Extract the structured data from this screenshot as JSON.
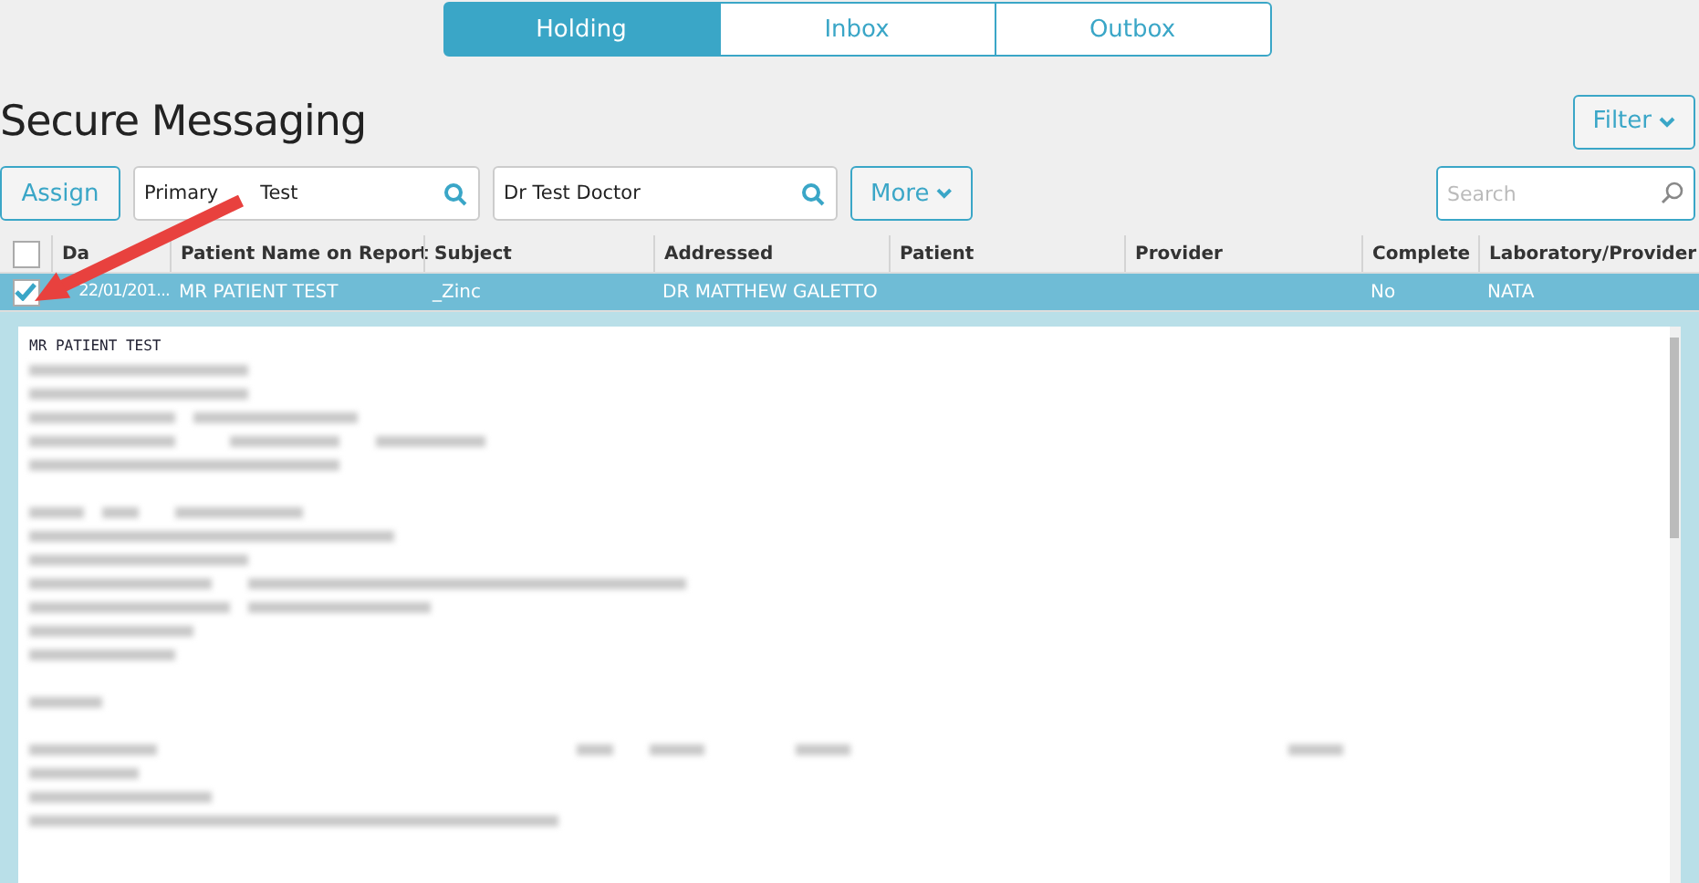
{
  "tabs": [
    {
      "label": "Holding",
      "selected": true
    },
    {
      "label": "Inbox",
      "selected": false
    },
    {
      "label": "Outbox",
      "selected": false
    }
  ],
  "title": "Secure Messaging",
  "filter_button": "Filter",
  "toolbar": {
    "assign_button": "Assign",
    "field_1": [
      "Primary",
      "Test"
    ],
    "field_2": "Dr Test Doctor",
    "more_button": "More",
    "search": {
      "placeholder": "Search"
    }
  },
  "table": {
    "columns": [
      "Da",
      "Patient Name on Report",
      "Subject",
      "Addressed",
      "Patient",
      "Provider",
      "Complete",
      "Laboratory/Provider"
    ],
    "all_checked": false,
    "rows": [
      {
        "checked": true,
        "selected": true,
        "expanded": true,
        "cells": [
          "22/01/201...",
          "MR PATIENT TEST",
          "_Zinc",
          "DR MATTHEW GALETTO",
          "",
          "",
          "No",
          "NATA"
        ]
      }
    ]
  },
  "detail": {
    "heading": "MR PATIENT TEST"
  }
}
